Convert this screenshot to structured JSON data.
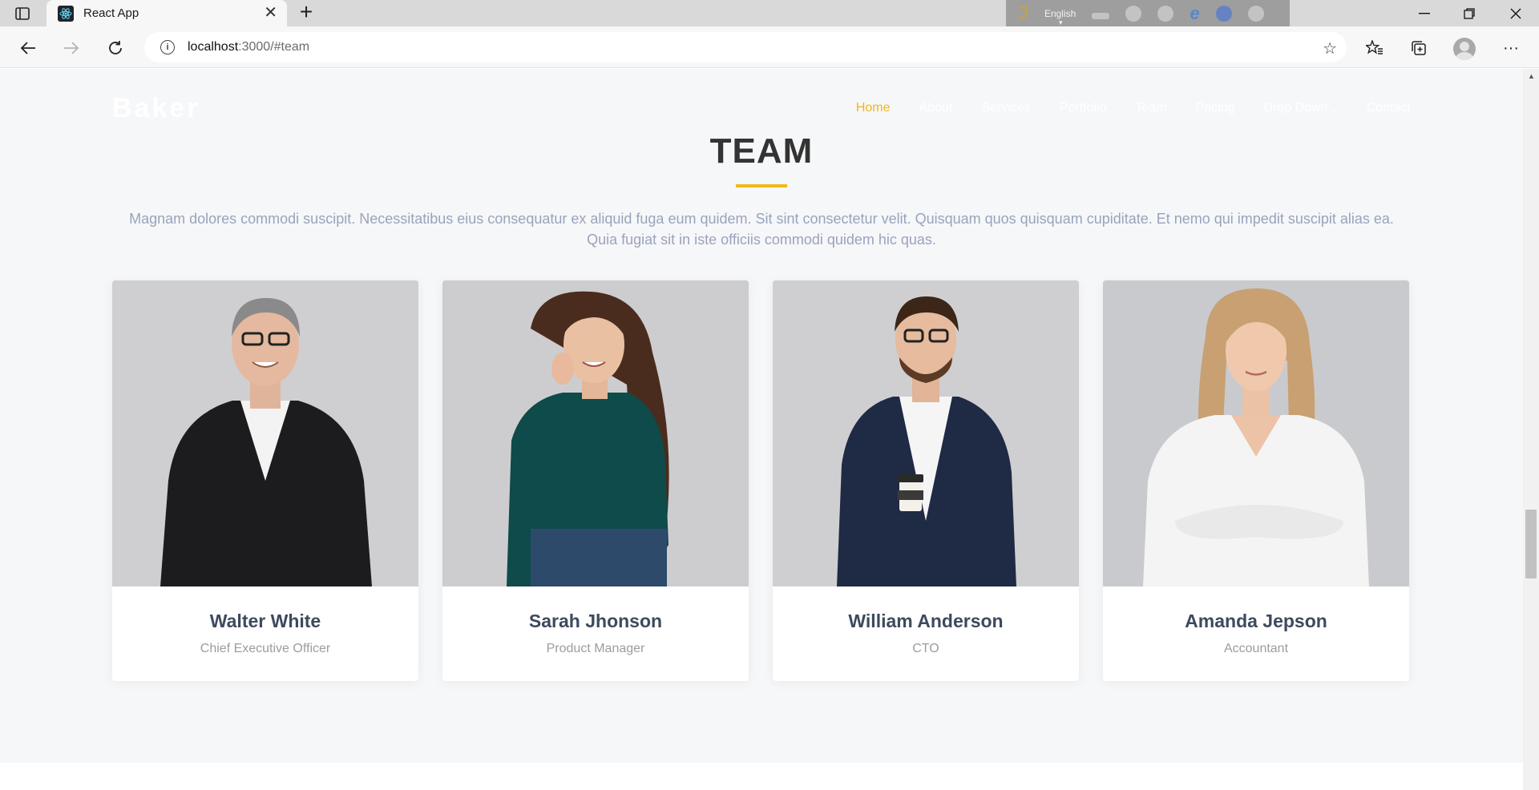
{
  "browser": {
    "tab_title": "React App",
    "url_host": "localhost",
    "url_path": ":3000/#team",
    "extension_language": "English"
  },
  "site": {
    "logo": "Baker",
    "nav": [
      {
        "label": "Home"
      },
      {
        "label": "About"
      },
      {
        "label": "Services"
      },
      {
        "label": "Portfolio"
      },
      {
        "label": "Team"
      },
      {
        "label": "Pricing"
      },
      {
        "label": "Drop Down"
      },
      {
        "label": "Contact"
      }
    ],
    "accent_color": "#f0b81b"
  },
  "team": {
    "title": "TEAM",
    "description": "Magnam dolores commodi suscipit. Necessitatibus eius consequatur ex aliquid fuga eum quidem. Sit sint consectetur velit. Quisquam quos quisquam cupiditate. Et nemo qui impedit suscipit alias ea. Quia fugiat sit in iste officiis commodi quidem hic quas.",
    "members": [
      {
        "name": "Walter White",
        "role": "Chief Executive Officer"
      },
      {
        "name": "Sarah Jhonson",
        "role": "Product Manager"
      },
      {
        "name": "William Anderson",
        "role": "CTO"
      },
      {
        "name": "Amanda Jepson",
        "role": "Accountant"
      }
    ]
  }
}
